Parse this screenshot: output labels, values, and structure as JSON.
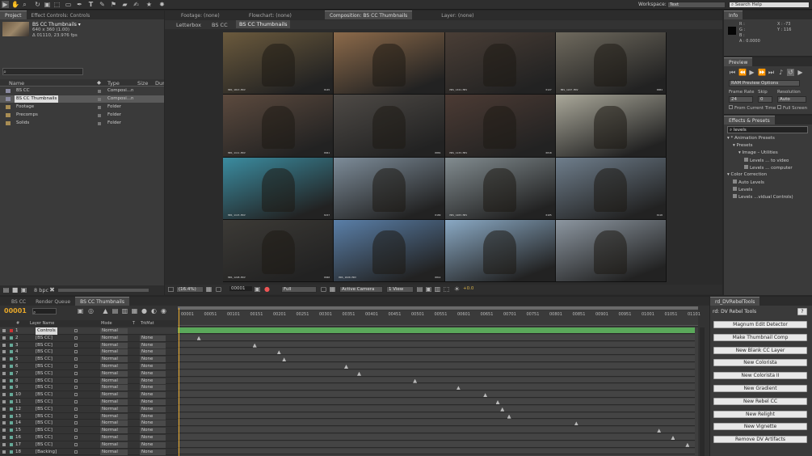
{
  "toolbar": {
    "workspace_label": "Workspace:",
    "workspace_value": "Text",
    "search_help": "Search Help"
  },
  "project": {
    "tabs": [
      "Project",
      "Effect Controls: Controls"
    ],
    "item_name": "BS CC Thumbnails ▾",
    "item_res": "640 x 360 (1.00)",
    "item_dur": "Δ 01110, 23.976 fps",
    "columns": [
      "Name",
      "Type",
      "Size",
      "Dur"
    ],
    "items": [
      {
        "name": "BS CC",
        "type": "Composi...n",
        "folder": false,
        "selected": false
      },
      {
        "name": "BS CC Thumbnails",
        "type": "Composi...n",
        "folder": false,
        "selected": true
      },
      {
        "name": "Footage",
        "type": "Folder",
        "folder": true,
        "selected": false
      },
      {
        "name": "Precomps",
        "type": "Folder",
        "folder": true,
        "selected": false
      },
      {
        "name": "Solids",
        "type": "Folder",
        "folder": true,
        "selected": false
      }
    ],
    "bpc": "8 bpc"
  },
  "comp_viewer": {
    "tabs": [
      "Footage: (none)",
      "Flowchart: (none)",
      "Composition: BS CC Thumbnails",
      "Layer: (none)"
    ],
    "breadcrumbs": [
      "Letterbox",
      "BS CC",
      "BS CC Thumbnails"
    ],
    "zoom": "(16.4%)",
    "timecode": "00001",
    "resolution": "Full",
    "camera": "Active Camera",
    "views": "1 View",
    "exposure": "+0.0",
    "thumbs": [
      {
        "label": "HRS_1013.MOV",
        "tc": "0145",
        "color": "#6b5a3d"
      },
      {
        "label": "",
        "tc": "",
        "color": "#8c6a4a"
      },
      {
        "label": "HRS_1321.MOV",
        "tc": "0127",
        "color": "#4a3e36"
      },
      {
        "label": "HRS_1227.MOV",
        "tc": "0004",
        "color": "#6f6a5e"
      },
      {
        "label": "HRS_1111.MOV",
        "tc": "0041",
        "color": "#5c4a3e"
      },
      {
        "label": "",
        "tc": "0001",
        "color": "#4e4a46"
      },
      {
        "label": "HRS_1133.MOV",
        "tc": "0018",
        "color": "#4c3b34"
      },
      {
        "label": "",
        "tc": "",
        "color": "#aaa89a"
      },
      {
        "label": "HRS_1115.MOV",
        "tc": "0217",
        "color": "#3b8ca0"
      },
      {
        "label": "",
        "tc": "0109",
        "color": "#7d8c99"
      },
      {
        "label": "HRS_1203.MOV",
        "tc": "0105",
        "color": "#828c90"
      },
      {
        "label": "",
        "tc": "0118",
        "color": "#6f7e8c"
      },
      {
        "label": "HRS_1228.MOV",
        "tc": "0040",
        "color": "#3c3a36"
      },
      {
        "label": "HRS_1020.MOV",
        "tc": "0014",
        "color": "#5a7fa8"
      },
      {
        "label": "",
        "tc": "",
        "color": "#8aa9c4"
      },
      {
        "label": "",
        "tc": "",
        "color": "#8c96a0"
      }
    ]
  },
  "info": {
    "title": "Info",
    "r": "R :",
    "g": "G :",
    "b": "B :",
    "a": "A : 0.0000",
    "x": "X : -73",
    "y": "Y : 116"
  },
  "preview": {
    "title": "Preview",
    "ram_options": "RAM Preview Options",
    "frame_rate_label": "Frame Rate",
    "skip_label": "Skip",
    "resolution_label": "Resolution",
    "frame_rate": "24",
    "skip": "0",
    "resolution": "Auto",
    "from_current": "From Current Time",
    "full_screen": "Full Screen"
  },
  "effects": {
    "title": "Effects & Presets",
    "search": "levels",
    "tree": [
      {
        "text": "▾ * Animation Presets",
        "indent": 0
      },
      {
        "text": "▾ Presets",
        "indent": 1
      },
      {
        "text": "▾ Image – Utilities",
        "indent": 2
      },
      {
        "text": "Levels ... to video",
        "indent": 3
      },
      {
        "text": "Levels ... computer",
        "indent": 3
      },
      {
        "text": "▾ Color Correction",
        "indent": 0
      },
      {
        "text": "Auto Levels",
        "indent": 1
      },
      {
        "text": "Levels",
        "indent": 1
      },
      {
        "text": "Levels ...vidual Controls)",
        "indent": 1
      }
    ]
  },
  "timeline": {
    "tabs": [
      "BS CC",
      "Render Queue",
      "BS CC Thumbnails"
    ],
    "timecode": "00001",
    "columns": [
      "#",
      "Layer Name",
      "Mode",
      "T",
      "TrkMat"
    ],
    "ruler": [
      "00001",
      "00051",
      "00101",
      "00151",
      "00201",
      "00251",
      "00301",
      "00351",
      "00401",
      "00451",
      "00501",
      "00551",
      "00601",
      "00651",
      "00701",
      "00751",
      "00801",
      "00851",
      "00901",
      "00951",
      "01001",
      "01051",
      "01101"
    ],
    "layers": [
      {
        "num": "1",
        "name": "Controls",
        "mode": "Normal",
        "trk": "",
        "kf": null
      },
      {
        "num": "2",
        "name": "[BS CC]",
        "mode": "Normal",
        "trk": "None",
        "kf": 0.04
      },
      {
        "num": "3",
        "name": "[BS CC]",
        "mode": "Normal",
        "trk": "None",
        "kf": 0.148
      },
      {
        "num": "4",
        "name": "[BS CC]",
        "mode": "Normal",
        "trk": "None",
        "kf": 0.195
      },
      {
        "num": "5",
        "name": "[BS CC]",
        "mode": "Normal",
        "trk": "None",
        "kf": 0.205
      },
      {
        "num": "6",
        "name": "[BS CC]",
        "mode": "Normal",
        "trk": "None",
        "kf": 0.325
      },
      {
        "num": "7",
        "name": "[BS CC]",
        "mode": "Normal",
        "trk": "None",
        "kf": 0.35
      },
      {
        "num": "8",
        "name": "[BS CC]",
        "mode": "Normal",
        "trk": "None",
        "kf": 0.458
      },
      {
        "num": "9",
        "name": "[BS CC]",
        "mode": "Normal",
        "trk": "None",
        "kf": 0.542
      },
      {
        "num": "10",
        "name": "[BS CC]",
        "mode": "Normal",
        "trk": "None",
        "kf": 0.594
      },
      {
        "num": "11",
        "name": "[BS CC]",
        "mode": "Normal",
        "trk": "None",
        "kf": 0.618
      },
      {
        "num": "12",
        "name": "[BS CC]",
        "mode": "Normal",
        "trk": "None",
        "kf": 0.627
      },
      {
        "num": "13",
        "name": "[BS CC]",
        "mode": "Normal",
        "trk": "None",
        "kf": 0.64
      },
      {
        "num": "14",
        "name": "[BS CC]",
        "mode": "Normal",
        "trk": "None",
        "kf": 0.77
      },
      {
        "num": "15",
        "name": "[BS CC]",
        "mode": "Normal",
        "trk": "None",
        "kf": 0.93
      },
      {
        "num": "16",
        "name": "[BS CC]",
        "mode": "Normal",
        "trk": "None",
        "kf": 0.957
      },
      {
        "num": "17",
        "name": "[BS CC]",
        "mode": "Normal",
        "trk": "None",
        "kf": 0.985
      },
      {
        "num": "18",
        "name": "[Backing]",
        "mode": "Normal",
        "trk": "None",
        "kf": null
      }
    ]
  },
  "rebel": {
    "tab": "rd_DVRebelTools",
    "title": "rd: DV Rebel Tools",
    "help": "?",
    "buttons": [
      "Magnum Edit Detector",
      "Make Thumbnail Comp",
      "New Blank CC Layer",
      "New Colorista",
      "New Colorista II",
      "New Gradient",
      "New Rebel CC",
      "New Relight",
      "New Vignette",
      "Remove DV Artifacts"
    ]
  }
}
